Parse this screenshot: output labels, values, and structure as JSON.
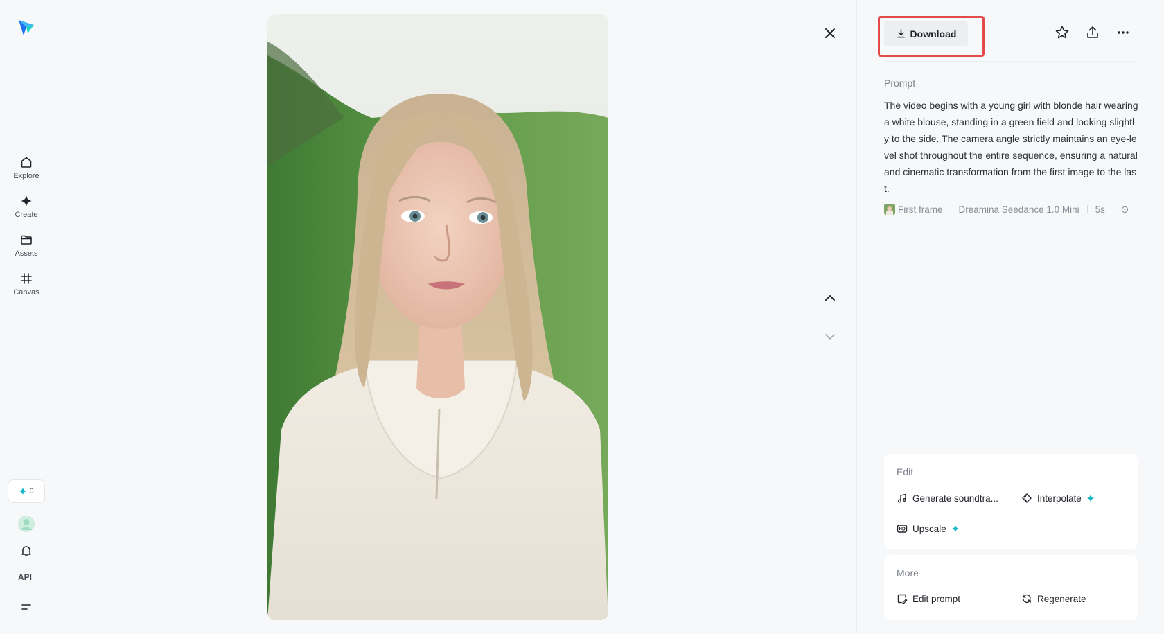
{
  "nav": {
    "items": [
      {
        "label": "Explore",
        "icon": "home-icon"
      },
      {
        "label": "Create",
        "icon": "diamond-icon"
      },
      {
        "label": "Assets",
        "icon": "folder-icon"
      },
      {
        "label": "Canvas",
        "icon": "frame-icon"
      }
    ],
    "credits": "0",
    "api_label": "API"
  },
  "viewer": {
    "content": "photo of a young girl with blonde hair in a white blouse standing in a green field"
  },
  "panel": {
    "download_label": "Download",
    "prompt_label": "Prompt",
    "prompt_text": "The video begins with a young girl with blonde hair wearing a white blouse, standing in a green field and looking slightly to the side. The camera angle strictly maintains an eye-level shot throughout the entire sequence, ensuring a natural and cinematic transformation from the first image to the last.",
    "meta": {
      "frame": "First frame",
      "model": "Dreamina Seedance 1.0 Mini",
      "duration": "5s"
    },
    "edit": {
      "title": "Edit",
      "generate_soundtrack": "Generate soundtra...",
      "interpolate": "Interpolate",
      "upscale": "Upscale"
    },
    "more": {
      "title": "More",
      "edit_prompt": "Edit prompt",
      "regenerate": "Regenerate"
    }
  },
  "colors": {
    "accent_spark": "#12b8c4",
    "highlight_outline": "#e34b4b",
    "background": "#f7f8fa"
  }
}
